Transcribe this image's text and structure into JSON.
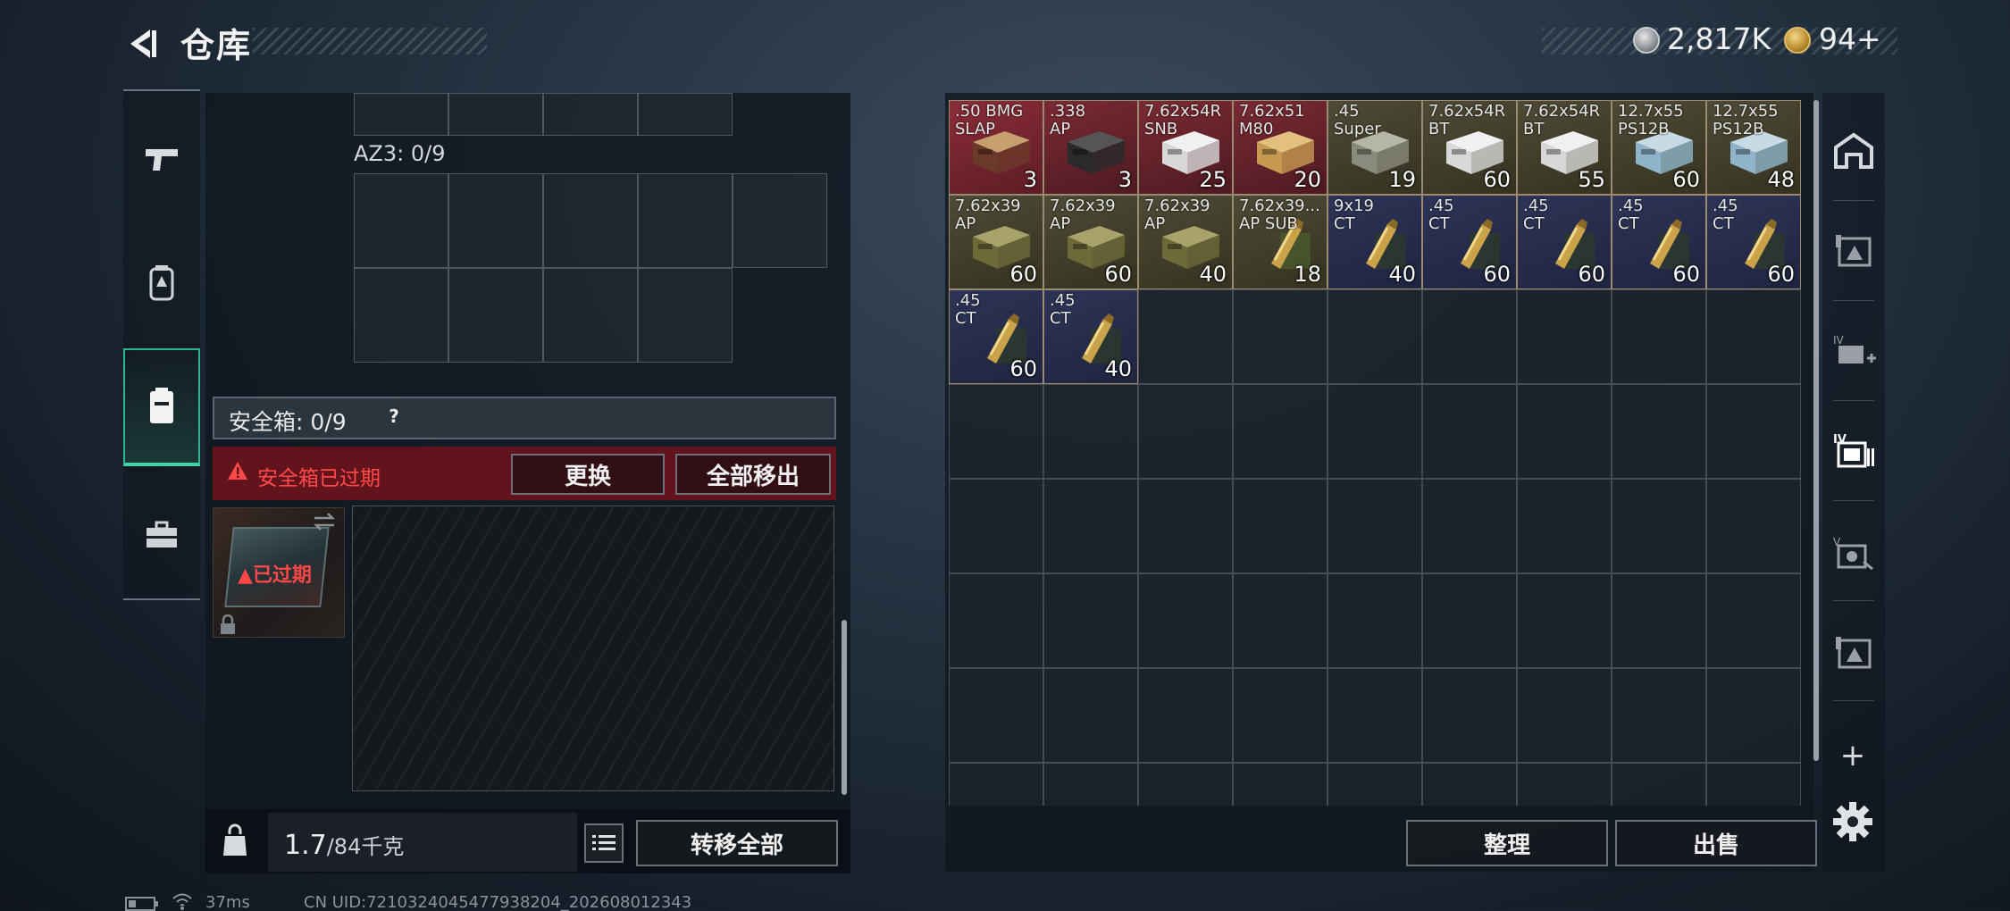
{
  "header": {
    "title": "仓库"
  },
  "currency": {
    "silver": "2,817K",
    "gold": "94+"
  },
  "left_panel": {
    "az3_label": "AZ3: 0/9",
    "safe_box_label": "安全箱: 0/9",
    "safe_box_help": "?",
    "warning_text": "安全箱已过期",
    "replace_button": "更换",
    "move_all_button": "全部移出",
    "expired_tag": "已过期",
    "weight_value": "1.7",
    "weight_max": "/84千克",
    "transfer_all_button": "转移全部"
  },
  "right_panel": {
    "sort_button": "整理",
    "sell_button": "出售",
    "items": [
      {
        "label": ".50 BMG\nSLAP",
        "count": "3"
      },
      {
        "label": ".338\nAP",
        "count": "3"
      },
      {
        "label": "7.62x54R\nSNB",
        "count": "25"
      },
      {
        "label": "7.62x51\nM80",
        "count": "20"
      },
      {
        "label": ".45\nSuper",
        "count": "19"
      },
      {
        "label": "7.62x54R\nBT",
        "count": "60"
      },
      {
        "label": "7.62x54R\nBT",
        "count": "55"
      },
      {
        "label": "12.7x55\nPS12B",
        "count": "60"
      },
      {
        "label": "12.7x55\nPS12B",
        "count": "48"
      },
      {
        "label": "7.62x39\nAP",
        "count": "60"
      },
      {
        "label": "7.62x39\nAP",
        "count": "60"
      },
      {
        "label": "7.62x39\nAP",
        "count": "40"
      },
      {
        "label": "7.62x39...\nAP SUB",
        "count": "18"
      },
      {
        "label": "9x19\nCT",
        "count": "40"
      },
      {
        "label": ".45\nCT",
        "count": "60"
      },
      {
        "label": ".45\nCT",
        "count": "60"
      },
      {
        "label": ".45\nCT",
        "count": "60"
      },
      {
        "label": ".45\nCT",
        "count": "60"
      },
      {
        "label": ".45\nCT",
        "count": "60"
      },
      {
        "label": ".45\nCT",
        "count": "40"
      }
    ]
  },
  "status_bar": {
    "ping": "37ms",
    "uid": "CN UID:7210324045477938204_202608012343"
  },
  "colors": {
    "accent": "#2fb48d",
    "warning": "#ff4a4a",
    "item_red": "#7a2530",
    "item_olive": "#4a4530",
    "item_blue": "#2c3350"
  },
  "icons": [
    "back-arrow-icon",
    "silver-coin-icon",
    "gold-coin-icon",
    "pistol-icon",
    "backpack-icon",
    "safe-box-icon",
    "toolbox-icon",
    "warning-icon",
    "swap-icon",
    "lock-icon",
    "weight-icon",
    "list-icon",
    "gear-icon",
    "plus-icon"
  ]
}
